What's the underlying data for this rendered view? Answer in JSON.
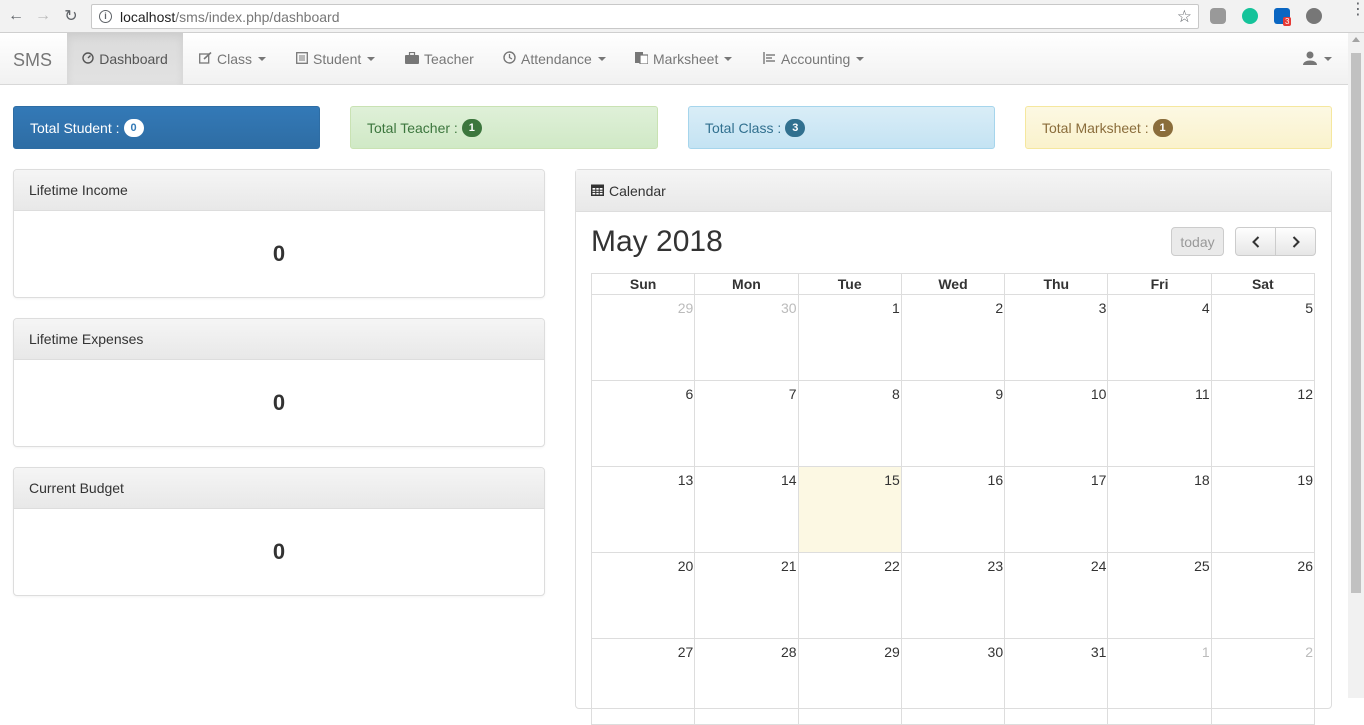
{
  "browser": {
    "url_host": "localhost",
    "url_path": "/sms/index.php/dashboard",
    "ext_badge": "3"
  },
  "navbar": {
    "brand": "SMS",
    "items": [
      {
        "label": "Dashboard",
        "icon": "dashboard-icon",
        "dropdown": false,
        "active": true
      },
      {
        "label": "Class",
        "icon": "edit-icon",
        "dropdown": true
      },
      {
        "label": "Student",
        "icon": "list-icon",
        "dropdown": true
      },
      {
        "label": "Teacher",
        "icon": "briefcase-icon",
        "dropdown": false
      },
      {
        "label": "Attendance",
        "icon": "clock-icon",
        "dropdown": true
      },
      {
        "label": "Marksheet",
        "icon": "paste-icon",
        "dropdown": true
      },
      {
        "label": "Accounting",
        "icon": "indent-icon",
        "dropdown": true
      }
    ],
    "user_icon": "user-icon"
  },
  "stats": {
    "student": {
      "label": "Total Student :",
      "count": "0",
      "color": "#337ab7"
    },
    "teacher": {
      "label": "Total Teacher :",
      "count": "1",
      "color": "#3c763d"
    },
    "class": {
      "label": "Total Class :",
      "count": "3",
      "color": "#31708f"
    },
    "marksheet": {
      "label": "Total Marksheet :",
      "count": "1",
      "color": "#8a6d3b"
    }
  },
  "panels": {
    "income": {
      "title": "Lifetime Income",
      "value": "0"
    },
    "expenses": {
      "title": "Lifetime Expenses",
      "value": "0"
    },
    "budget": {
      "title": "Current Budget",
      "value": "0"
    }
  },
  "calendar": {
    "heading": "Calendar",
    "title": "May 2018",
    "today_label": "today",
    "weekdays": [
      "Sun",
      "Mon",
      "Tue",
      "Wed",
      "Thu",
      "Fri",
      "Sat"
    ],
    "weeks": [
      [
        "29",
        "30",
        "1",
        "2",
        "3",
        "4",
        "5"
      ],
      [
        "6",
        "7",
        "8",
        "9",
        "10",
        "11",
        "12"
      ],
      [
        "13",
        "14",
        "15",
        "16",
        "17",
        "18",
        "19"
      ],
      [
        "20",
        "21",
        "22",
        "23",
        "24",
        "25",
        "26"
      ],
      [
        "27",
        "28",
        "29",
        "30",
        "31",
        "1",
        "2"
      ]
    ],
    "highlight_color": "#fcf8e3"
  }
}
